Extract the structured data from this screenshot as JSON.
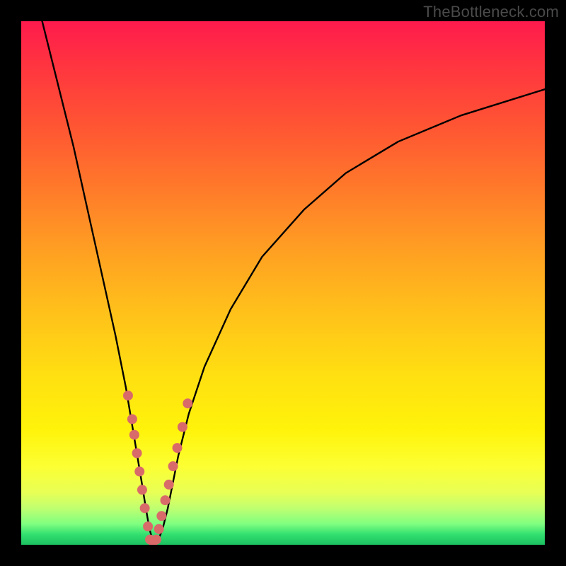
{
  "watermark": "TheBottleneck.com",
  "chart_data": {
    "type": "line",
    "title": "",
    "xlabel": "",
    "ylabel": "",
    "xlim": [
      0,
      100
    ],
    "ylim": [
      0,
      100
    ],
    "grid": false,
    "legend": false,
    "gradient_colors": {
      "top": "#ff1a4d",
      "mid_upper": "#ff7a2a",
      "mid": "#ffe011",
      "mid_lower": "#fcff33",
      "bottom": "#1cc060"
    },
    "series": [
      {
        "name": "bottleneck-curve",
        "stroke": "#000000",
        "stroke_width": 2.4,
        "x": [
          4,
          6,
          8,
          10,
          12,
          14,
          16,
          18,
          20,
          21,
          22,
          23,
          23.8,
          24.5,
          25.2,
          26,
          27,
          28,
          29,
          30,
          32,
          35,
          40,
          46,
          54,
          62,
          72,
          84,
          100
        ],
        "y": [
          100,
          92,
          84,
          76,
          67,
          58,
          49,
          40,
          30,
          24,
          18,
          12,
          7,
          3,
          0.5,
          0.5,
          3,
          7,
          12,
          17,
          25,
          34,
          45,
          55,
          64,
          71,
          77,
          82,
          87
        ]
      },
      {
        "name": "highlight-dots-left",
        "type": "scatter",
        "marker": "circle",
        "marker_size": 14,
        "fill": "#d96a6a",
        "x": [
          20.4,
          21.2,
          21.6,
          22.1,
          22.6,
          23.1,
          23.6,
          24.2
        ],
        "y": [
          28.5,
          24.0,
          21.0,
          17.5,
          14.0,
          10.5,
          7.0,
          3.5
        ]
      },
      {
        "name": "highlight-dots-bottom",
        "type": "scatter",
        "marker": "circle",
        "marker_size": 14,
        "fill": "#d96a6a",
        "x": [
          24.6,
          25.2,
          25.8
        ],
        "y": [
          1.0,
          0.6,
          1.0
        ]
      },
      {
        "name": "highlight-dots-right",
        "type": "scatter",
        "marker": "circle",
        "marker_size": 14,
        "fill": "#d96a6a",
        "x": [
          26.3,
          26.8,
          27.5,
          28.2,
          29.0,
          29.8,
          30.8,
          31.8
        ],
        "y": [
          3.0,
          5.5,
          8.5,
          11.5,
          15.0,
          18.5,
          22.5,
          27.0
        ]
      }
    ]
  }
}
